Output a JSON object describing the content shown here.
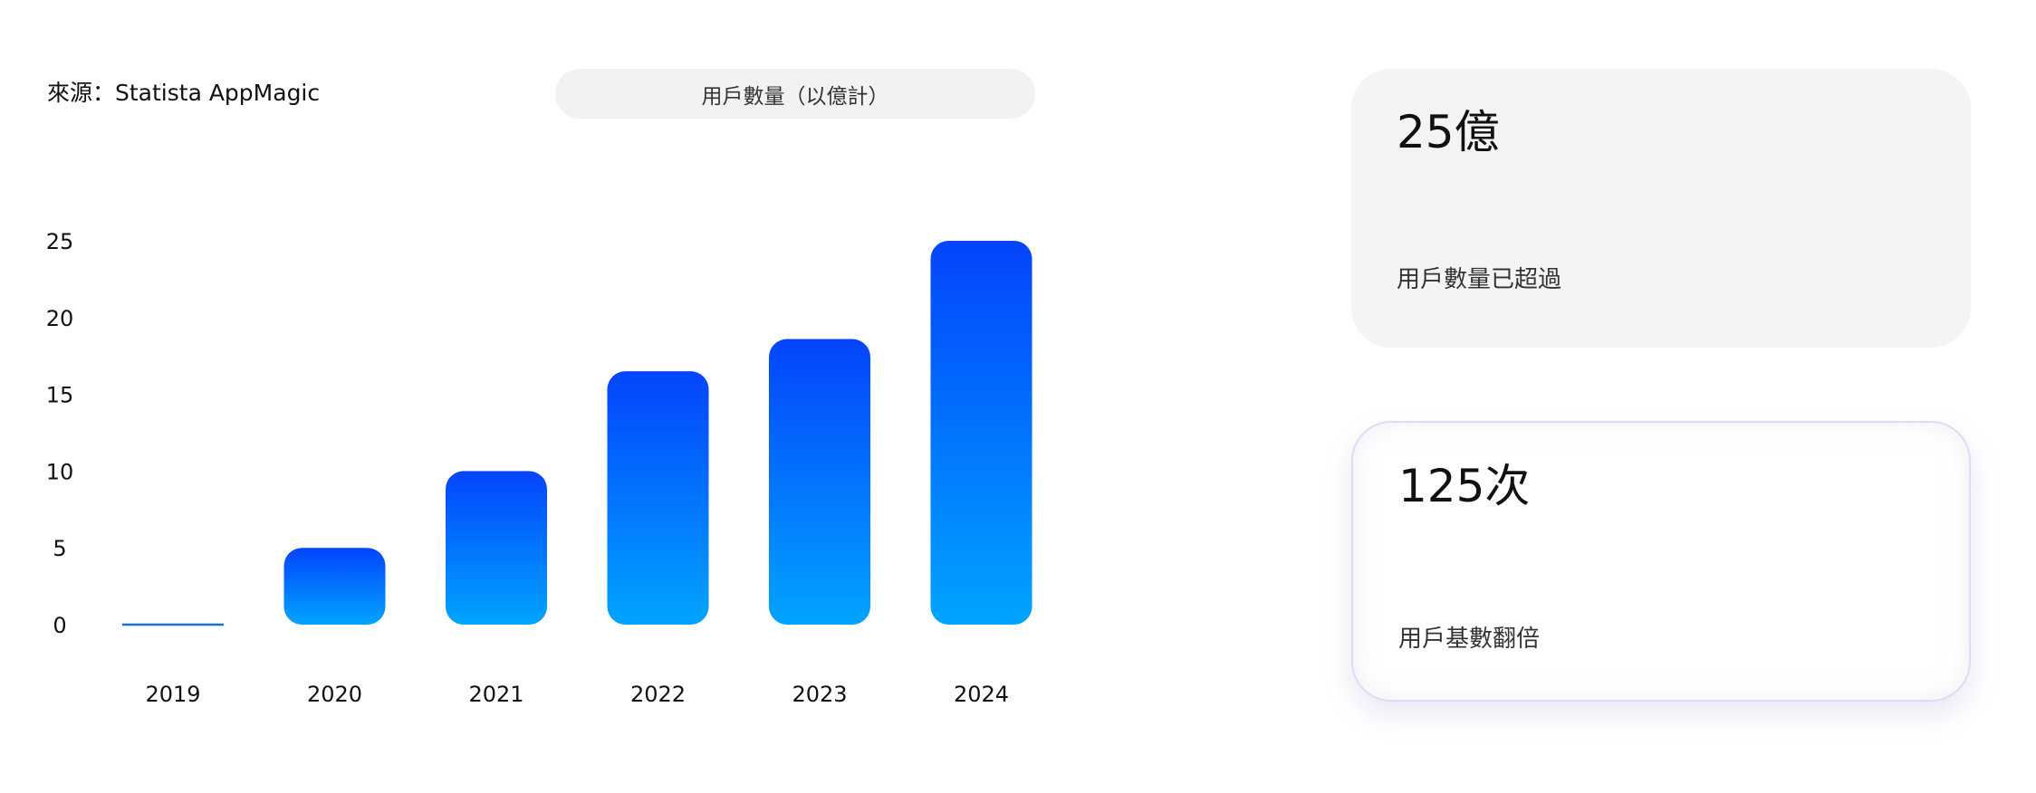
{
  "source_text": "來源：Statista AppMagic",
  "legend_label": "用戶數量（以億計）",
  "colors": {
    "bar_top": "#0444fb",
    "bar_bottom": "#00a4ff",
    "baseline": "#1a6fd4",
    "card_gray": "#f4f4f4",
    "card_border": "#dcdcf6"
  },
  "chart_data": {
    "type": "bar",
    "categories": [
      "2019",
      "2020",
      "2021",
      "2022",
      "2023",
      "2024"
    ],
    "values": [
      0,
      5,
      10,
      16.5,
      18.6,
      25
    ],
    "ylim": [
      0,
      25
    ],
    "yticks": [
      "0",
      "5",
      "10",
      "15",
      "20",
      "25"
    ],
    "grid": false
  },
  "stats": [
    {
      "value": "25億",
      "label": "用戶數量已超過"
    },
    {
      "value": "125次",
      "label": "用戶基數翻倍"
    }
  ]
}
